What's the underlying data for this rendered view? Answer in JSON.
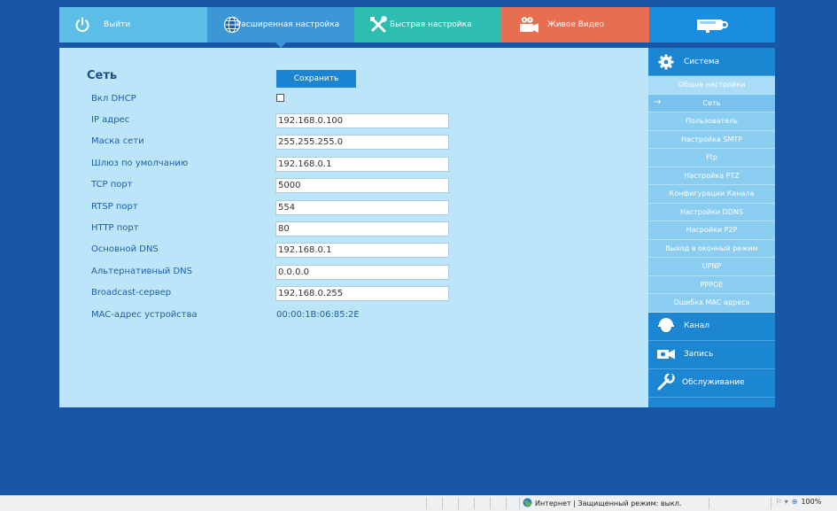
{
  "nav": {
    "logout": "Выйти",
    "advanced": "Расширенная настройка",
    "quick": "Быстрая настройка",
    "live": "Живое Видео"
  },
  "main": {
    "title": "Сеть",
    "save_label": "Сохранить",
    "fields": {
      "dhcp": {
        "label": "Вкл DHCP",
        "checked": false
      },
      "ip": {
        "label": "IP адрес",
        "value": "192.168.0.100"
      },
      "mask": {
        "label": "Маска сети",
        "value": "255.255.255.0"
      },
      "gateway": {
        "label": "Шлюз по умолчанию",
        "value": "192.168.0.1"
      },
      "tcp": {
        "label": "TCP порт",
        "value": "5000"
      },
      "rtsp": {
        "label": "RTSP порт",
        "value": "554"
      },
      "http": {
        "label": "HTTP порт",
        "value": "80"
      },
      "dns1": {
        "label": "Основной DNS",
        "value": "192.168.0.1"
      },
      "dns2": {
        "label": "Альтернативный DNS",
        "value": "0.0.0.0"
      },
      "broadcast": {
        "label": "Broadcast-сервер",
        "value": "192.168.0.255"
      },
      "mac": {
        "label": "MAC-адрес устройства",
        "value": "00:00:1B:06:85:2E"
      }
    }
  },
  "sidebar": {
    "system": "Система",
    "items": [
      "Общие настройки",
      "Сеть",
      "Пользователь",
      "Настройка SMTP",
      "Ftp",
      "Настройка PTZ",
      "Конфигурации Канала",
      "Настройки DDNS",
      "Насройки P2P",
      "Выход в оконный режим",
      "UPNP",
      "PPPOE",
      "Ошибка MAC адреса"
    ],
    "channel": "Канал",
    "record": "Запись",
    "maintenance": "Обслуживание"
  },
  "status": {
    "zone": "Интернет | Защищенный режим: выкл.",
    "zoom": "100%"
  }
}
